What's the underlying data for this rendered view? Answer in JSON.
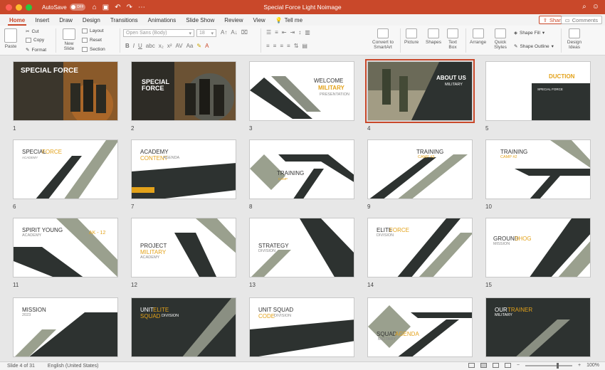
{
  "titlebar": {
    "autosave_label": "AutoSave",
    "autosave_state": "OFF",
    "document_title": "Special Force Light Noimage",
    "colors": {
      "accent": "#c9482a"
    }
  },
  "tabs": [
    "Home",
    "Insert",
    "Draw",
    "Design",
    "Transitions",
    "Animations",
    "Slide Show",
    "Review",
    "View"
  ],
  "tell_me": "Tell me",
  "share_label": "Share",
  "comments_label": "Comments",
  "ribbon": {
    "paste": "Paste",
    "cut": "Cut",
    "copy": "Copy",
    "format": "Format",
    "new_slide": "New Slide",
    "layout": "Layout",
    "reset": "Reset",
    "section": "Section",
    "font_name": "Open Sans (Body)",
    "font_size": "18",
    "convert_smartart": "Convert to SmartArt",
    "picture": "Picture",
    "shapes": "Shapes",
    "text_box": "Text Box",
    "arrange": "Arrange",
    "quick_styles": "Quick Styles",
    "shape_fill": "Shape Fill",
    "shape_outline": "Shape Outline",
    "design_ideas": "Design Ideas"
  },
  "slides": [
    {
      "num": "1",
      "title": "SPECIAL FORCE"
    },
    {
      "num": "2",
      "title": "SPECIAL FORCE"
    },
    {
      "num": "3",
      "title": "WELCOME",
      "accent": "MILITARY",
      "sub": "PRESENTATION"
    },
    {
      "num": "4",
      "title": "ABOUT US",
      "sub": "MILITARY"
    },
    {
      "num": "5",
      "title": "DUCTION",
      "sub": "SPECIAL FORCE"
    },
    {
      "num": "6",
      "title": "SPECIAL",
      "accent": "FORCE",
      "sub": "ACADEMY"
    },
    {
      "num": "7",
      "title": "ACADEMY",
      "accent": "CONTENT",
      "sub": "AGENDA"
    },
    {
      "num": "8",
      "title": "TRAINING",
      "sub": "CAMP"
    },
    {
      "num": "9",
      "title": "TRAINING",
      "sub": "CAMP #3"
    },
    {
      "num": "10",
      "title": "TRAINING",
      "sub": "CAMP #2"
    },
    {
      "num": "11",
      "title": "SPIRIT YOUNG",
      "sub": "ACADEMY",
      "accent": "AK - 12"
    },
    {
      "num": "12",
      "title": "PROJECT",
      "accent": "MILITARY",
      "sub": "ACADEMY"
    },
    {
      "num": "13",
      "title": "STRATEGY",
      "sub": "DIVISION"
    },
    {
      "num": "14",
      "title": "ELITE",
      "accent": "FORCE",
      "sub": "DIVISION"
    },
    {
      "num": "15",
      "title": "GROUND",
      "accent": "SHOG",
      "sub": "MISSION"
    },
    {
      "num": "16",
      "title": "MISSION",
      "sub": "2023"
    },
    {
      "num": "17",
      "title": "UNIT",
      "accent": "ELITE",
      "accent2": "SQUAD",
      "sub": "DIVISION"
    },
    {
      "num": "18",
      "title": "UNIT SQUAD",
      "accent": "CODE",
      "sub": "DIVISION"
    },
    {
      "num": "19",
      "title": "SQUAD",
      "accent": "AGENDA",
      "sub": "MILITARY"
    },
    {
      "num": "20",
      "title": "OUR",
      "accent": "TRAINER",
      "sub": "MILITARY"
    }
  ],
  "status": {
    "slide_counter": "Slide 4 of 31",
    "language": "English (United States)",
    "zoom": "100%"
  }
}
